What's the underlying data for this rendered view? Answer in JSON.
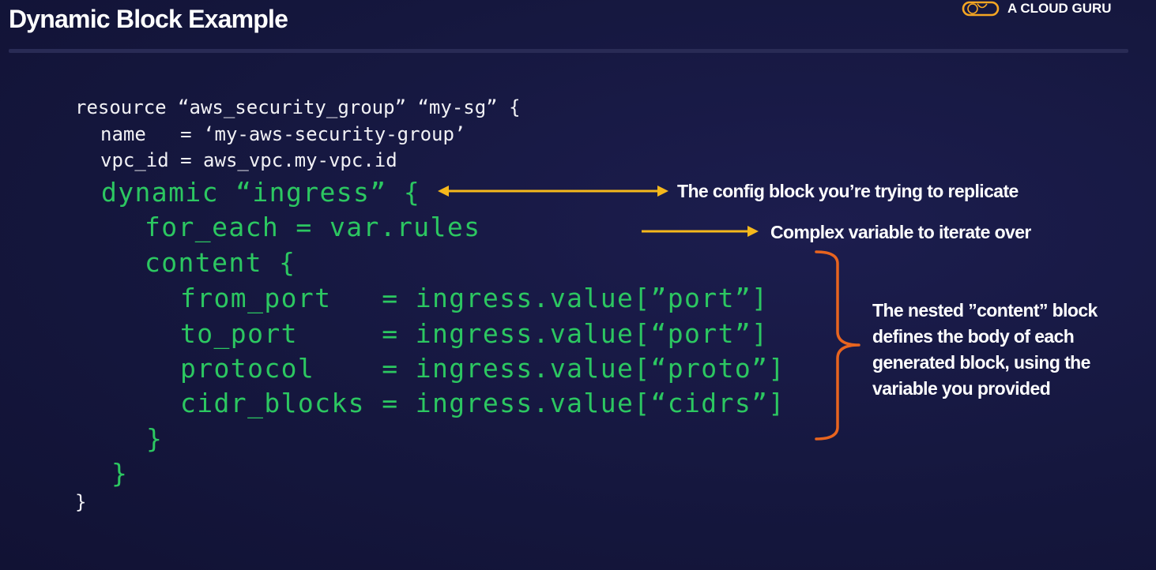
{
  "slide": {
    "title": "Dynamic Block Example"
  },
  "brand": {
    "name": "A CLOUD GURU",
    "logo_icon": "cloud-guru-logo-icon"
  },
  "code": {
    "line1": "resource “aws_security_group” “my-sg” {",
    "line2": "name   = ‘my-aws-security-group’",
    "line3": "vpc_id = aws_vpc.my-vpc.id",
    "line4": "dynamic “ingress” {",
    "line5": "for_each = var.rules",
    "line6": "content {",
    "line7": "from_port   = ingress.value[”port”]",
    "line8": "to_port     = ingress.value[“port”]",
    "line9": "protocol    = ingress.value[“proto”]",
    "line10": "cidr_blocks = ingress.value[“cidrs”]",
    "line11": "}",
    "line12": "}",
    "line13": "}"
  },
  "annotations": {
    "config_block": "The config block you’re trying to replicate",
    "complex_variable": "Complex variable to iterate over",
    "content_block": "The nested ”content” block defines the body of each generated block, using the variable you provided"
  },
  "colors": {
    "background": "#15173e",
    "code_default": "#f1f1f5",
    "code_highlight": "#2cc761",
    "arrow": "#f5b81c",
    "brace": "#e8641f",
    "divider": "#292b55"
  }
}
